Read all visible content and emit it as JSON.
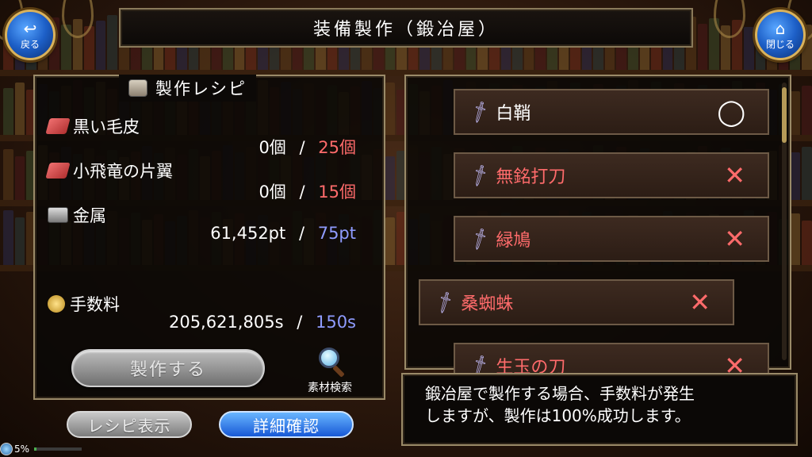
{
  "header": {
    "title": "装備製作（鍛冶屋）",
    "back_label": "戻る",
    "close_label": "閉じる"
  },
  "recipe": {
    "title": "製作レシピ",
    "materials": [
      {
        "name": "黒い毛皮",
        "icon": "fur-icon",
        "owned": "0個",
        "separator": "/",
        "required": "25個",
        "required_color": "#ff6b6b"
      },
      {
        "name": "小飛竜の片翼",
        "icon": "fur-icon",
        "owned": "0個",
        "separator": "/",
        "required": "15個",
        "required_color": "#ff6b6b"
      },
      {
        "name": "金属",
        "icon": "metal-icon",
        "owned": "61,452pt",
        "separator": "/",
        "required": "75pt",
        "required_color": "#8f9cff"
      }
    ],
    "fee": {
      "name": "手数料",
      "icon": "coin-icon",
      "owned": "205,621,805s",
      "separator": "/",
      "required": "150s",
      "required_color": "#8f9cff"
    },
    "craft_label": "製作する",
    "search_label": "素材検索"
  },
  "bottom_buttons": {
    "recipe_display": "レシピ表示",
    "detail_confirm": "詳細確認"
  },
  "status": {
    "percent": "5%",
    "progress": 0.05
  },
  "list": {
    "items": [
      {
        "name": "白鞘",
        "craftable": true,
        "name_color": "#ffffff",
        "mark": "◯"
      },
      {
        "name": "無銘打刀",
        "craftable": false,
        "name_color": "#ff6b6b",
        "mark": "✕"
      },
      {
        "name": "緑鳩",
        "craftable": false,
        "name_color": "#ff6b6b",
        "mark": "✕"
      },
      {
        "name": "桑蜘蛛",
        "craftable": false,
        "name_color": "#ff6b6b",
        "mark": "✕",
        "selected": true
      },
      {
        "name": "生玉の刀",
        "craftable": false,
        "name_color": "#ff6b6b",
        "mark": "✕"
      }
    ]
  },
  "message": {
    "line1": "鍛冶屋で製作する場合、手数料が発生",
    "line2": "しますが、製作は100%成功します。"
  },
  "colors": {
    "accent_blue": "#1d5fc7",
    "gold_border": "#d9b25c",
    "warning_red": "#ff6b6b",
    "ok_blue": "#8f9cff"
  }
}
